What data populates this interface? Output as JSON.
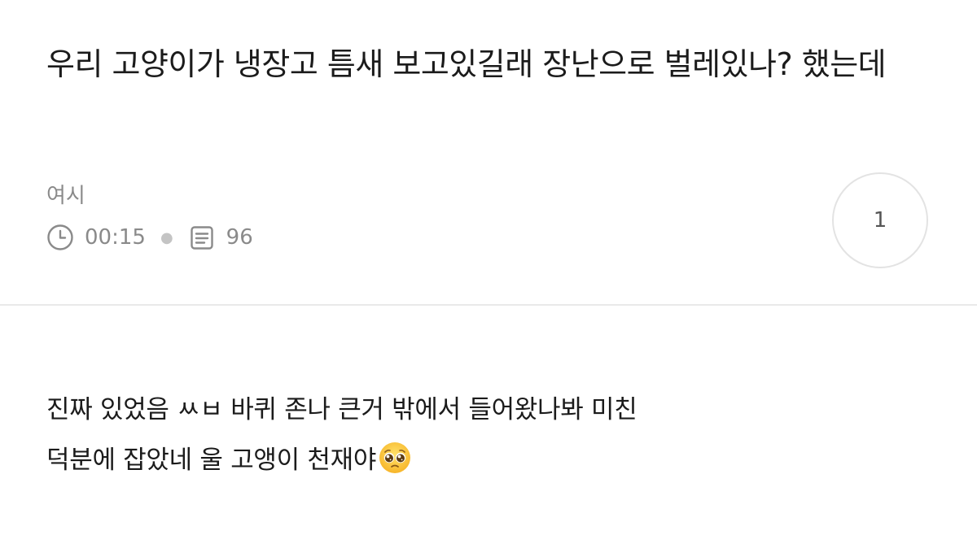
{
  "post": {
    "title": "우리 고양이가 냉장고 틈새 보고있길래 장난으로 벌레있나? 했는데",
    "author": "여시",
    "time": "00:15",
    "views": "96",
    "comment_count": "1",
    "body_lines": [
      "진짜 있었음 ㅆㅂ 바퀴 존나 큰거 밖에서 들어왔나봐 미친",
      "덕분에 잡았네 울 고앵이 천재야"
    ],
    "emoji": "pleading-face-emoji"
  },
  "icons": {
    "time": "clock-icon",
    "views": "document-icon"
  }
}
